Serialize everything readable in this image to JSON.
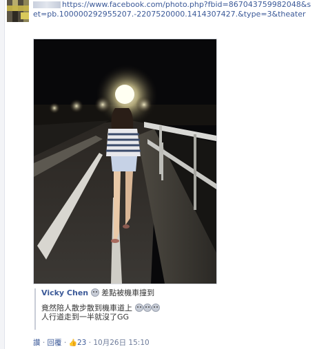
{
  "comment": {
    "url": "https://www.facebook.com/photo.php?fbid=867043759982048&set=pb.100000292955207.-2207520000.1414307427.&type=3&theater"
  },
  "quote": {
    "author": "Vicky Chen",
    "status": "差點被機車撞到",
    "line1": "竟然陪人散步散到機車道上",
    "line2": "人行道走到一半就沒了GG"
  },
  "actions": {
    "like": "讚",
    "separator": " · ",
    "reply": "回覆",
    "like_count": "23",
    "timestamp": "10月26日 15:10"
  },
  "icons": {
    "like": "thumbs-up-icon",
    "emoticon": "worried-face-icon"
  },
  "colors": {
    "link": "#3b5998",
    "meta": "#6d7b99"
  }
}
